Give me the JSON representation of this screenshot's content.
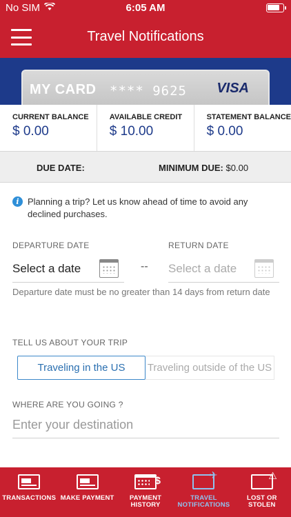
{
  "status_bar": {
    "carrier": "No SIM",
    "time": "6:05 AM",
    "battery_level": 0.8
  },
  "nav": {
    "title": "Travel Notifications"
  },
  "card": {
    "name": "MY CARD",
    "number_masked": "**** 9625",
    "brand": "VISA"
  },
  "balances": [
    {
      "label": "CURRENT BALANCE",
      "value": "$ 0.00"
    },
    {
      "label": "AVAILABLE CREDIT",
      "value": "$ 10.00"
    },
    {
      "label": "STATEMENT BALANCE",
      "value": "$ 0.00"
    }
  ],
  "due": {
    "due_date_label": "DUE DATE:",
    "min_due_label": "MINIMUM DUE:",
    "min_due_value": "$0.00"
  },
  "info": {
    "text": "Planning a trip? Let us know ahead of time to avoid any declined purchases."
  },
  "departure": {
    "label": "DEPARTURE DATE",
    "value": "Select a date"
  },
  "separator": "--",
  "return": {
    "label": "RETURN DATE",
    "placeholder": "Select a date"
  },
  "helper": "Departure date must be no greater than 14 days from return date",
  "trip": {
    "label": "TELL US ABOUT YOUR TRIP",
    "options": [
      "Traveling in the US",
      "Traveling outside of the US"
    ],
    "selected": "Traveling in the US"
  },
  "destination": {
    "label": "WHERE ARE YOU GOING ?",
    "placeholder": "Enter your destination"
  },
  "tabs": [
    {
      "label": "TRANSACTIONS",
      "icon": "card-icon"
    },
    {
      "label": "MAKE PAYMENT",
      "icon": "card-icon"
    },
    {
      "label": "PAYMENT HISTORY",
      "icon": "calendar-dollar-icon"
    },
    {
      "label": "TRAVEL NOTIFICATIONS",
      "icon": "card-plane-icon",
      "active": true
    },
    {
      "label": "LOST OR STOLEN",
      "icon": "card-alert-icon"
    }
  ],
  "colors": {
    "brand_red": "#c8202f",
    "navy": "#1d3a8a",
    "accent_blue": "#3b87c9",
    "active_tab": "#8fc2ef"
  }
}
